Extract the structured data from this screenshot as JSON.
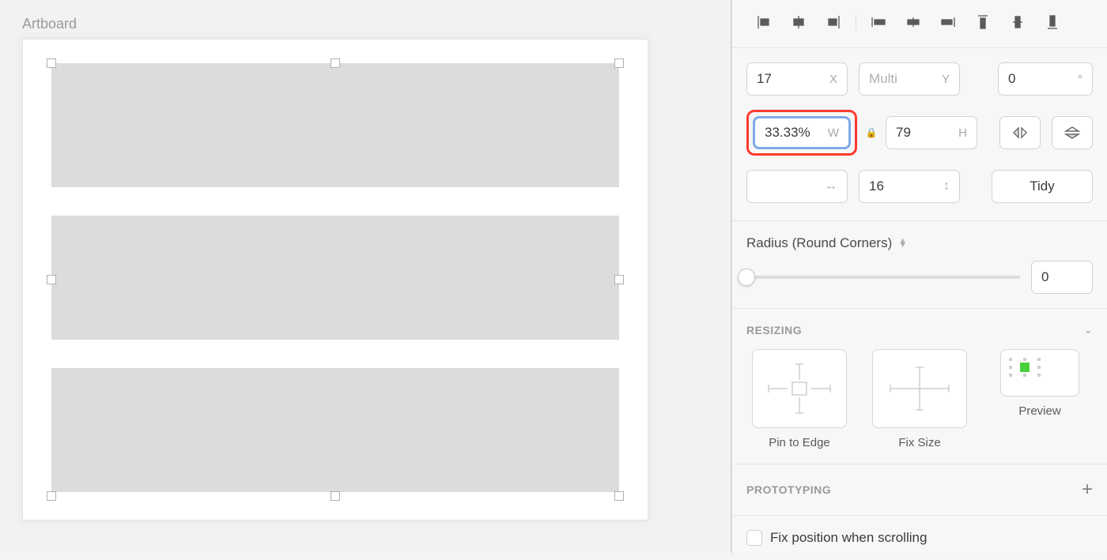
{
  "canvas": {
    "artboard_label": "Artboard"
  },
  "inspector": {
    "position": {
      "x": "17",
      "x_unit": "X",
      "y_placeholder": "Multi",
      "y_unit": "Y",
      "rotation": "0",
      "rotation_unit": "°"
    },
    "size": {
      "w": "33.33%",
      "w_unit": "W",
      "h": "79",
      "h_unit": "H"
    },
    "spacing": {
      "gap": "16",
      "tidy_label": "Tidy"
    },
    "radius": {
      "label": "Radius (Round Corners)",
      "value": "0"
    },
    "resizing": {
      "title": "RESIZING",
      "pin_label": "Pin to Edge",
      "fix_label": "Fix Size",
      "preview_label": "Preview"
    },
    "prototyping": {
      "title": "PROTOTYPING",
      "fix_position_label": "Fix position when scrolling"
    }
  }
}
